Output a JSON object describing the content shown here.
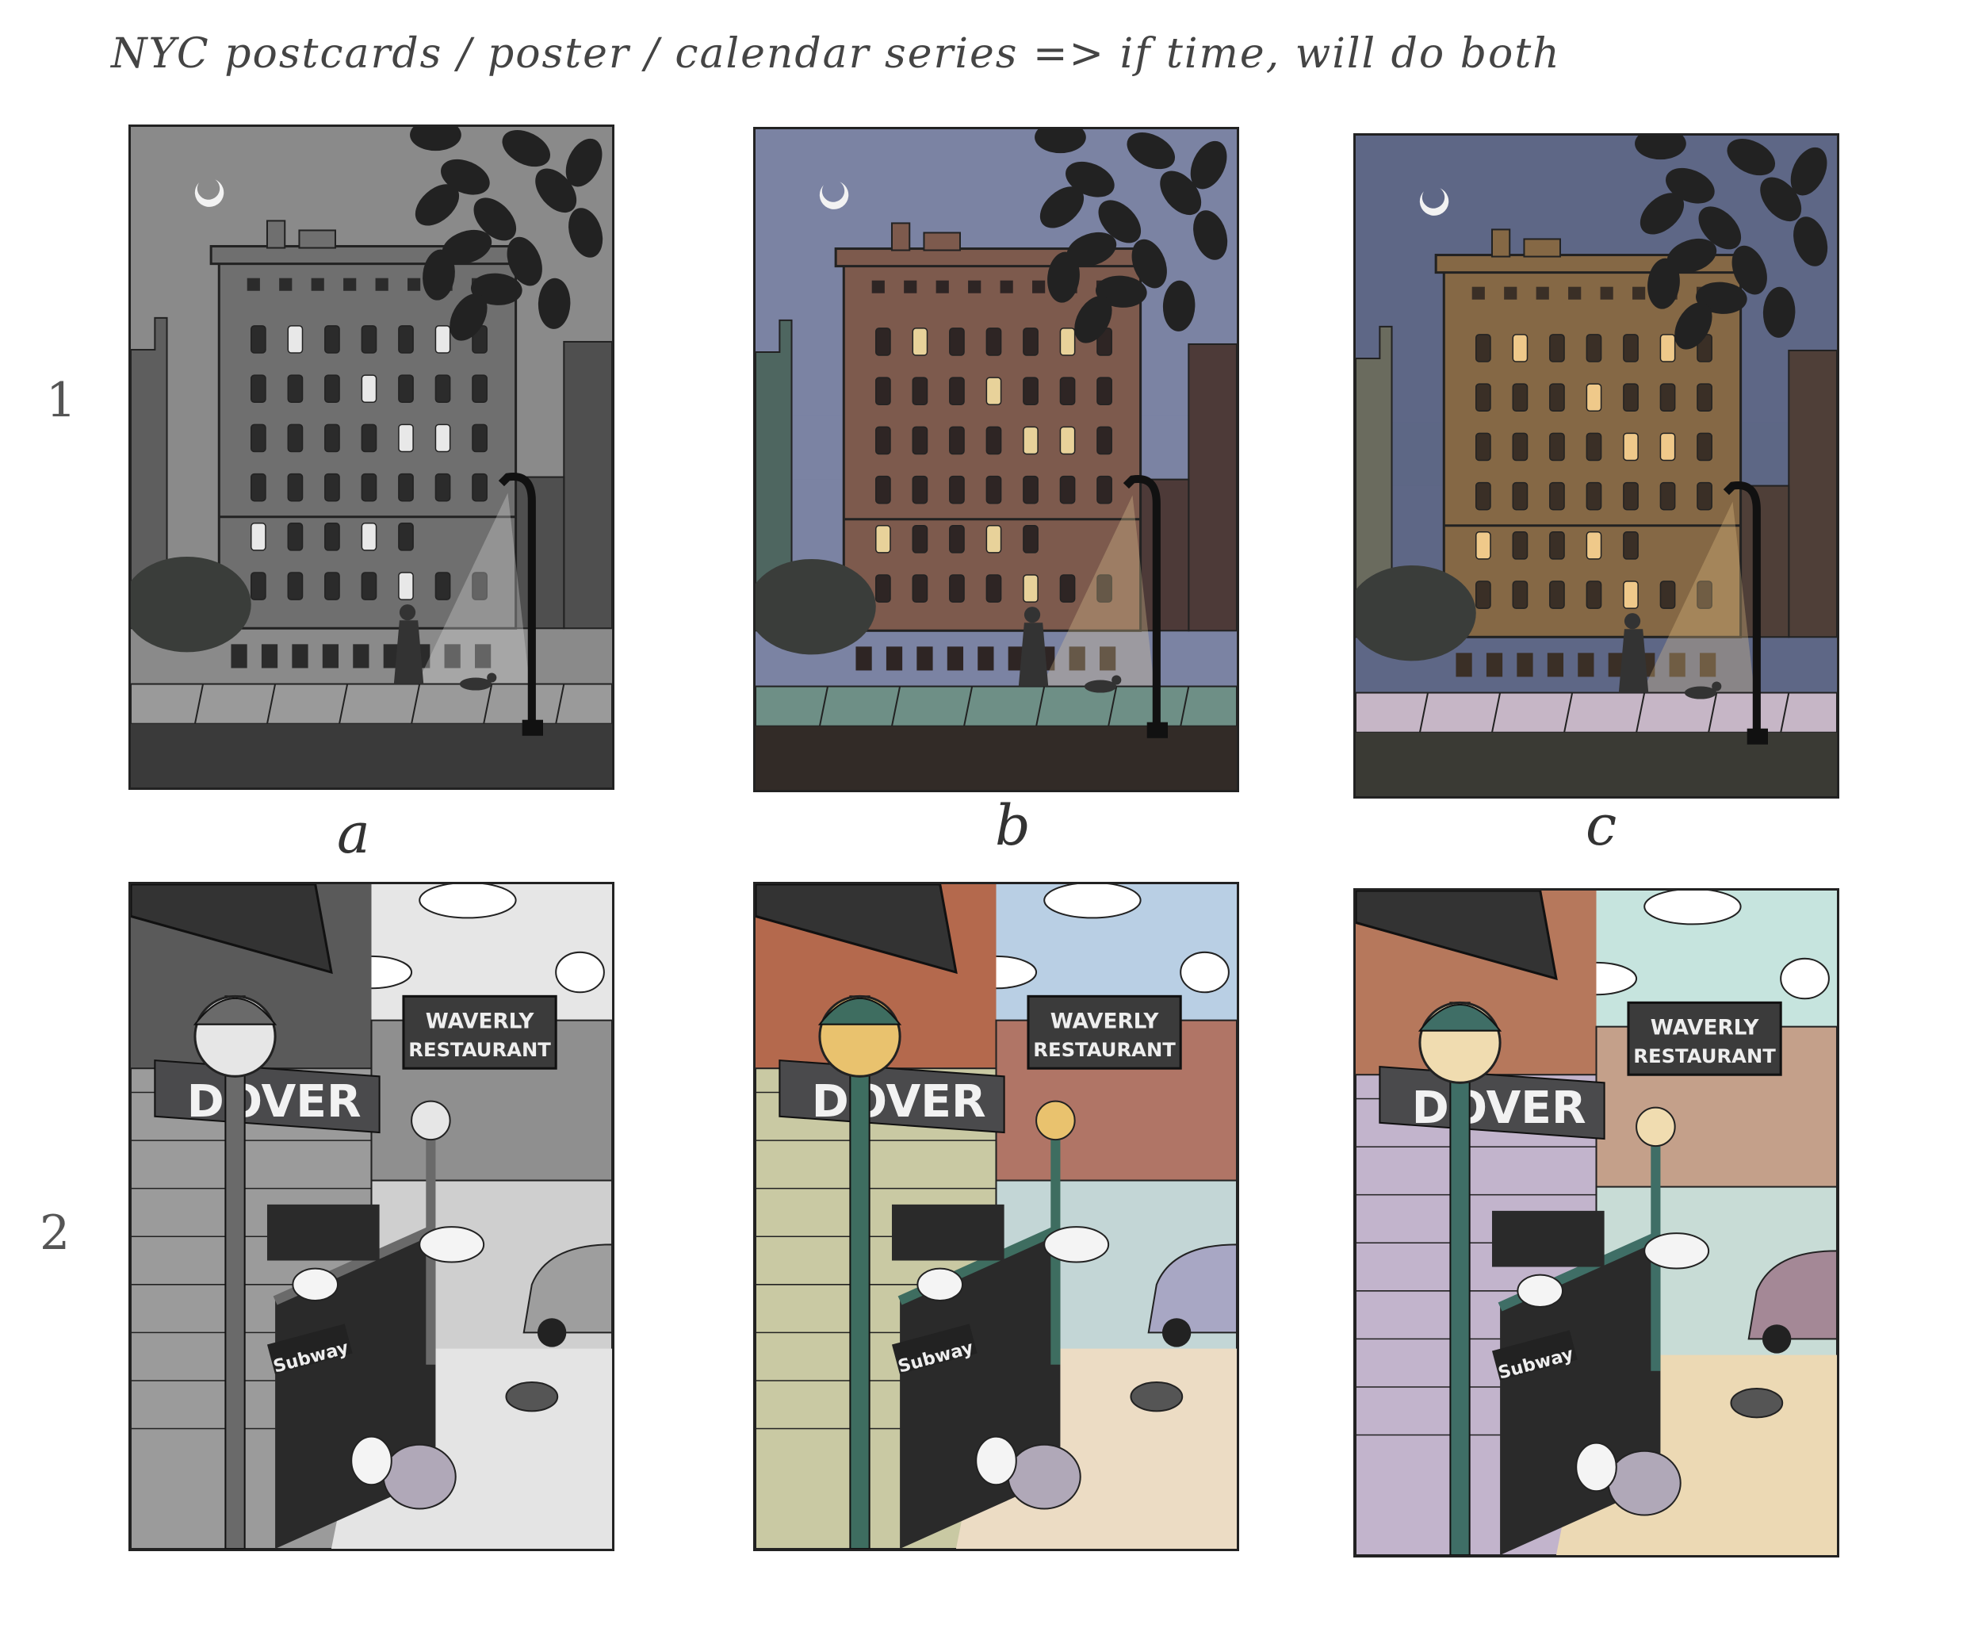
{
  "title": "NYC postcards / poster / calendar series => if time, will do both",
  "row_labels": [
    "1",
    "2"
  ],
  "column_labels": [
    "a",
    "b",
    "c"
  ],
  "signs": {
    "street": "DOVER",
    "restaurant_line1": "WAVERLY",
    "restaurant_line2": "RESTAURANT",
    "subway": "Subway"
  },
  "palettes": {
    "a": {
      "sky": "#8a8a8a",
      "building": "#6f6f6f",
      "side": "#4f4f4f",
      "left": "#5e5e5e",
      "street": "#3a3a3a",
      "sidewalk": "#9a9a9a",
      "window": "#2b2b2b",
      "lit": "#e8e8e8",
      "wall": "#9b9b9b",
      "awning": "#5a5a5a",
      "pole": "#6a6a6a",
      "globe": "#e6e6e6",
      "ground": "#e4e4e4",
      "back": "#cfcfcf",
      "sky2": "#e6e6e6",
      "car": "#9e9e9e",
      "bldg2": "#8f8f8f"
    },
    "b": {
      "sky": "#7b83a3",
      "building": "#7d5a4d",
      "side": "#4d3a38",
      "left": "#4e6660",
      "street": "#322b27",
      "sidewalk": "#6e8f86",
      "window": "#2e2524",
      "lit": "#e8d29a",
      "wall": "#c9c9a3",
      "awning": "#b4694d",
      "pole": "#3e6d60",
      "globe": "#e9c26e",
      "ground": "#ecdcc4",
      "back": "#c3d6d6",
      "sky2": "#b9cfe4",
      "car": "#a8a7c4",
      "bldg2": "#b07566"
    },
    "c": {
      "sky": "#5e6786",
      "building": "#856845",
      "side": "#4f3f38",
      "left": "#6a6b5e",
      "street": "#3a3a34",
      "sidewalk": "#c6b6c6",
      "window": "#3a2f26",
      "lit": "#efc98a",
      "wall": "#c2b4cc",
      "awning": "#b6785c",
      "pole": "#3f6e66",
      "globe": "#f0dcb0",
      "ground": "#ecd9b4",
      "back": "#c8dcd6",
      "sky2": "#c6e4de",
      "car": "#a48896",
      "bldg2": "#c4a08a"
    }
  }
}
